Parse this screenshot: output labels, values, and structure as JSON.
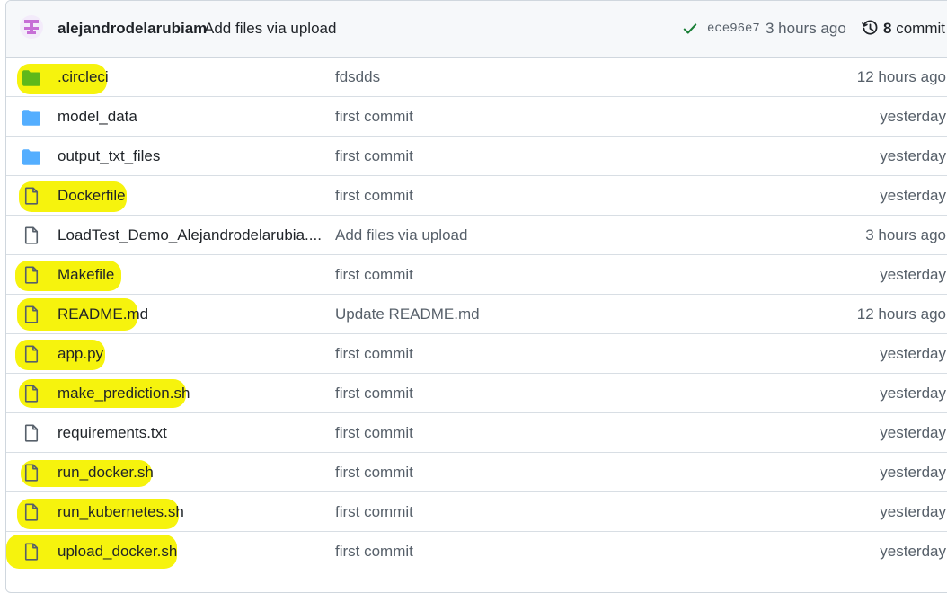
{
  "latest_commit": {
    "author": "alejandrodelarubiam",
    "message": "Add files via upload",
    "sha": "ece96e7",
    "time": "3 hours ago",
    "commits_count": "8",
    "commits_label": "commit"
  },
  "files": [
    {
      "name": ".circleci",
      "type": "folder",
      "folder_color": "#54aeff",
      "message": "fdsdds",
      "age": "12 hours ago",
      "highlight": true
    },
    {
      "name": "model_data",
      "type": "folder",
      "message": "first commit",
      "age": "yesterday",
      "highlight": false
    },
    {
      "name": "output_txt_files",
      "type": "folder",
      "message": "first commit",
      "age": "yesterday",
      "highlight": false
    },
    {
      "name": "Dockerfile",
      "type": "file",
      "message": "first commit",
      "age": "yesterday",
      "highlight": true
    },
    {
      "name": "LoadTest_Demo_Alejandrodelarubia....",
      "type": "file",
      "message": "Add files via upload",
      "age": "3 hours ago",
      "highlight": false
    },
    {
      "name": "Makefile",
      "type": "file",
      "message": "first commit",
      "age": "yesterday",
      "highlight": true
    },
    {
      "name": "README.md",
      "type": "file",
      "message": "Update README.md",
      "age": "12 hours ago",
      "highlight": true
    },
    {
      "name": "app.py",
      "type": "file",
      "message": "first commit",
      "age": "yesterday",
      "highlight": true
    },
    {
      "name": "make_prediction.sh",
      "type": "file",
      "message": "first commit",
      "age": "yesterday",
      "highlight": true
    },
    {
      "name": "requirements.txt",
      "type": "file",
      "message": "first commit",
      "age": "yesterday",
      "highlight": false
    },
    {
      "name": "run_docker.sh",
      "type": "file",
      "message": "first commit",
      "age": "yesterday",
      "highlight": true
    },
    {
      "name": "run_kubernetes.sh",
      "type": "file",
      "message": "first commit",
      "age": "yesterday",
      "highlight": true
    },
    {
      "name": "upload_docker.sh",
      "type": "file",
      "message": "first commit",
      "age": "yesterday",
      "highlight": true
    }
  ],
  "colors": {
    "highlight": "#f5f200",
    "folder": "#54aeff",
    "check": "#1a7f37",
    "avatar": "#c76fd6"
  },
  "icons": {
    "folder": "folder-icon",
    "file": "file-icon",
    "check": "check-icon",
    "history": "history-icon",
    "avatar": "avatar"
  }
}
